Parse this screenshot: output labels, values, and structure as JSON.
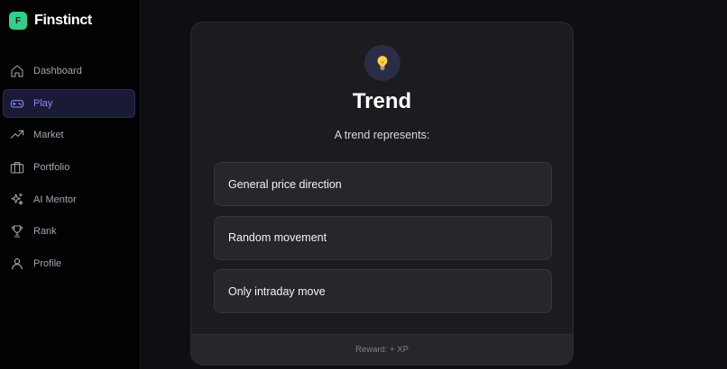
{
  "brand": {
    "logo_letter": "F",
    "name": "Finstinct",
    "accent": "#2fd08a"
  },
  "sidebar": {
    "active_color": "#8b84ff",
    "items": [
      {
        "label": "Dashboard",
        "icon": "home-icon",
        "active": false
      },
      {
        "label": "Play",
        "icon": "gamepad-icon",
        "active": true
      },
      {
        "label": "Market",
        "icon": "trending-up-icon",
        "active": false
      },
      {
        "label": "Portfolio",
        "icon": "briefcase-icon",
        "active": false
      },
      {
        "label": "AI Mentor",
        "icon": "sparkles-icon",
        "active": false
      },
      {
        "label": "Rank",
        "icon": "trophy-icon",
        "active": false
      },
      {
        "label": "Profile",
        "icon": "user-icon",
        "active": false
      }
    ]
  },
  "quiz": {
    "icon": "lightbulb-icon",
    "title": "Trend",
    "question": "A trend represents:",
    "options": [
      "General price direction",
      "Random movement",
      "Only intraday move"
    ],
    "footer": "Reward: + XP"
  }
}
